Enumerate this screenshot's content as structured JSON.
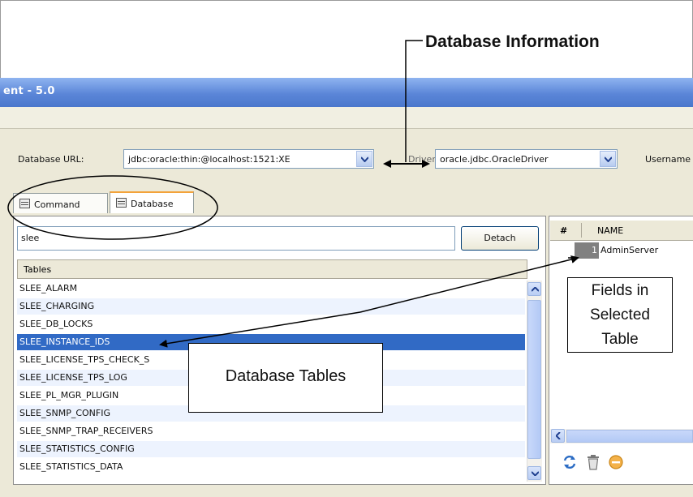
{
  "annotations": {
    "database_information": "Database Information",
    "database_tables": "Database Tables",
    "fields_line1": "Fields in",
    "fields_line2": "Selected",
    "fields_line3": "Table"
  },
  "window": {
    "title": "ent - 5.0"
  },
  "connection": {
    "db_url_label": "Database URL:",
    "db_url_value": "jdbc:oracle:thin:@localhost:1521:XE",
    "driver_label": "Driver:",
    "driver_value": "oracle.jdbc.OracleDriver",
    "username_label": "Username"
  },
  "tabs": [
    {
      "label": "Command",
      "selected": false
    },
    {
      "label": "Database",
      "selected": true
    }
  ],
  "search": {
    "value": "slee",
    "detach_label": "Detach"
  },
  "tables": {
    "header": "Tables",
    "rows": [
      "SLEE_ALARM",
      "SLEE_CHARGING",
      "SLEE_DB_LOCKS",
      "SLEE_INSTANCE_IDS",
      "SLEE_LICENSE_TPS_CHECK_S",
      "SLEE_LICENSE_TPS_LOG",
      "SLEE_PL_MGR_PLUGIN",
      "SLEE_SNMP_CONFIG",
      "SLEE_SNMP_TRAP_RECEIVERS",
      "SLEE_STATISTICS_CONFIG",
      "SLEE_STATISTICS_DATA"
    ],
    "selected_index": 3
  },
  "fields": {
    "col_num": "#",
    "col_name": "NAME",
    "rows": [
      {
        "num": "1",
        "name": "AdminServer"
      }
    ]
  },
  "icons": {
    "refresh": "refresh-icon",
    "delete": "trash-icon",
    "cancel": "cancel-icon"
  }
}
